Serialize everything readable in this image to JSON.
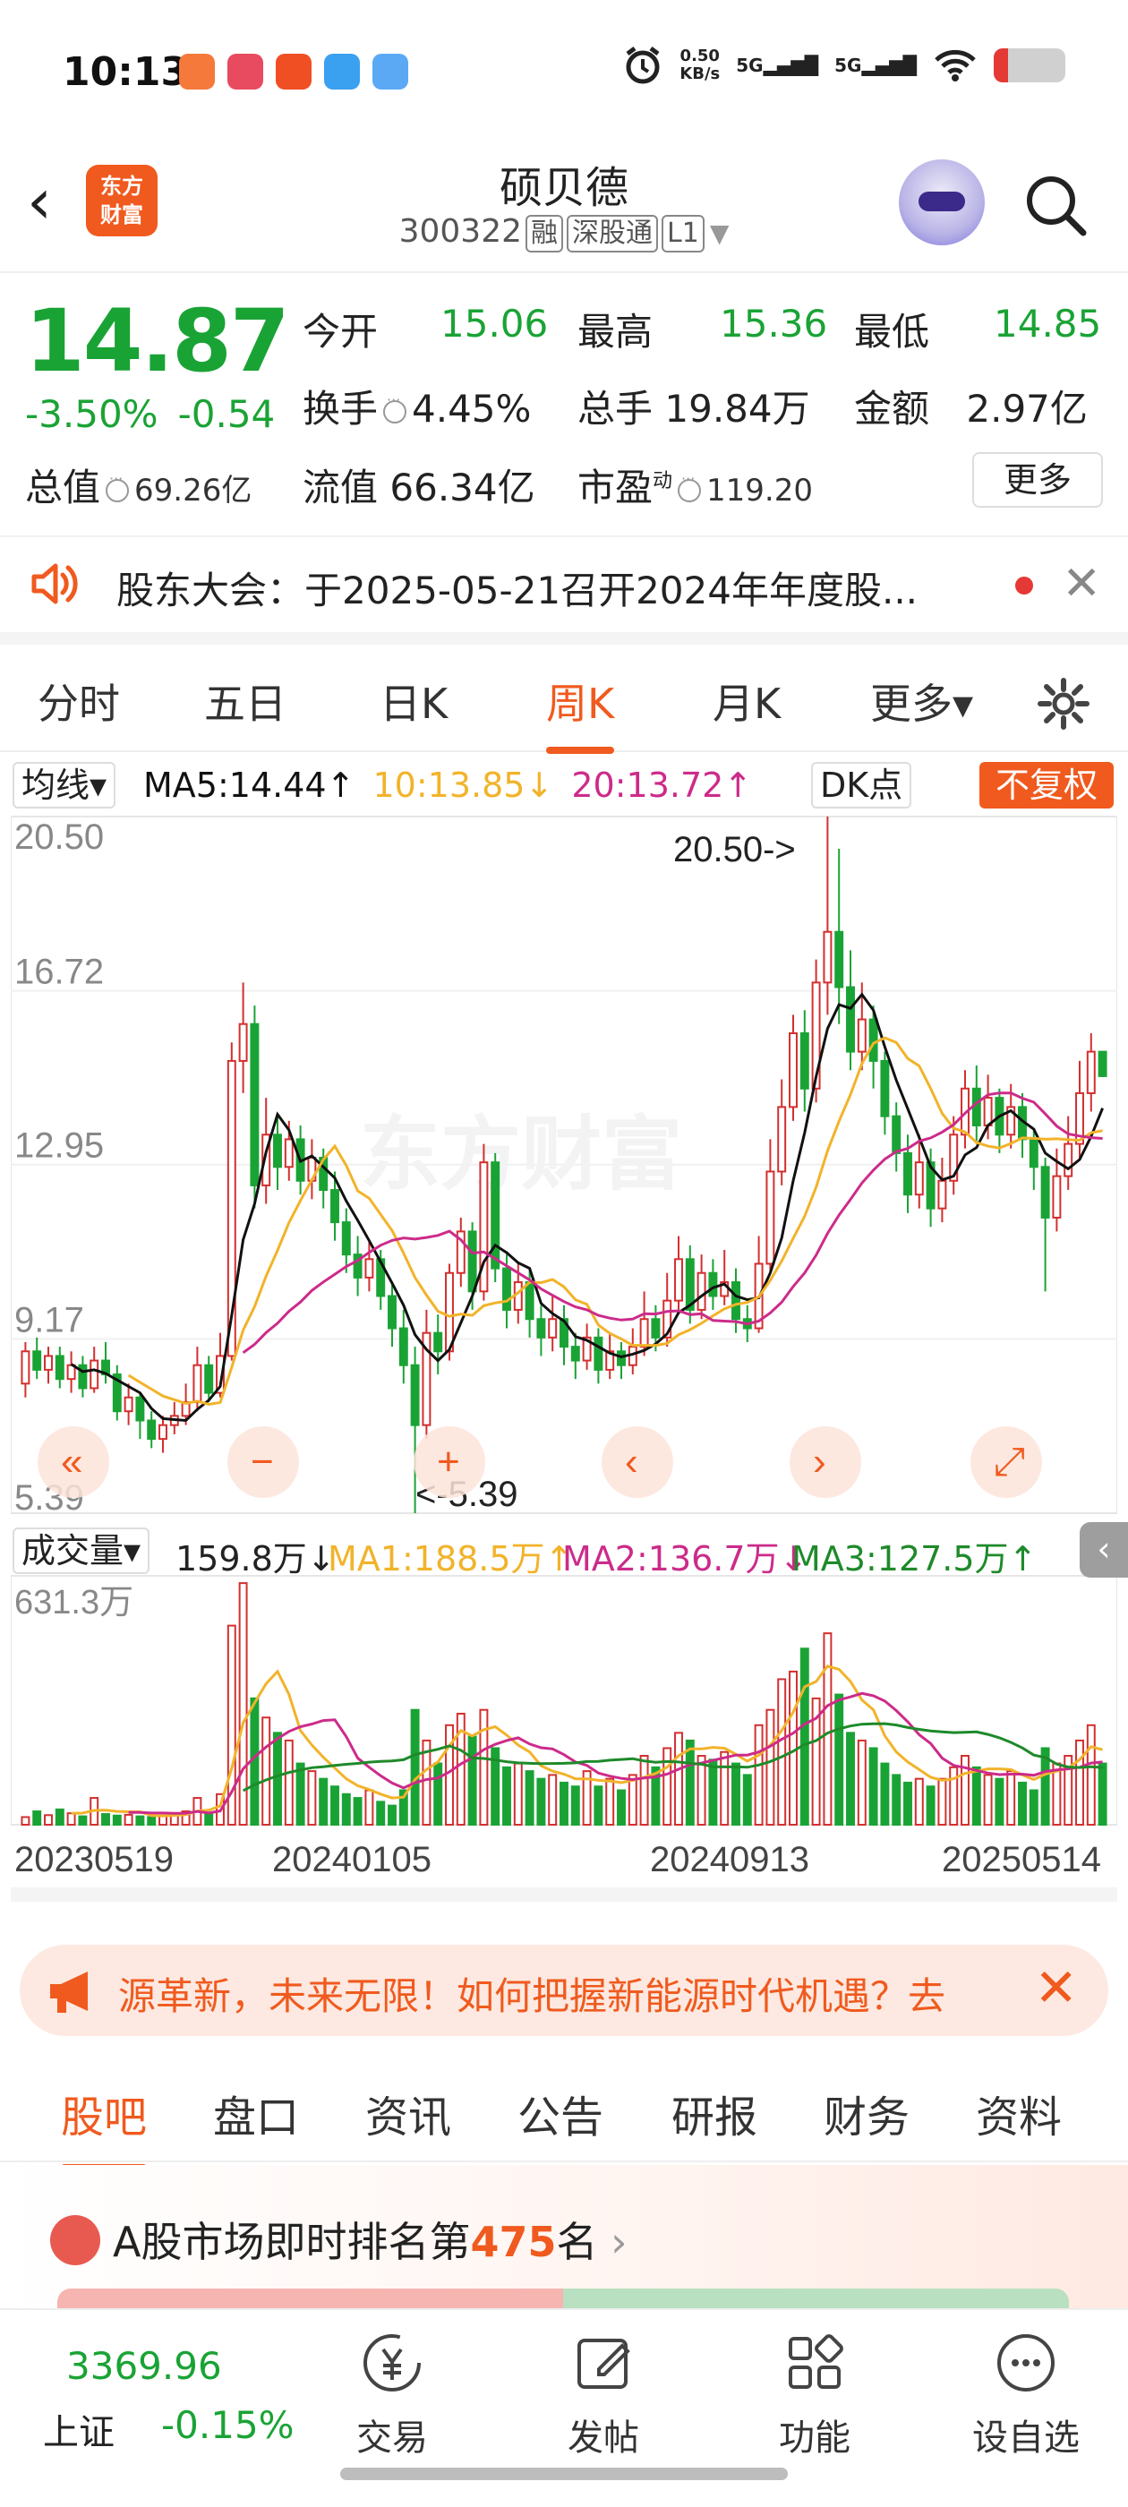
{
  "status_bar": {
    "time": "10:13",
    "net_speed": "0.50",
    "net_unit": "KB/s",
    "signal1": "5G",
    "signal2": "5G"
  },
  "header": {
    "logo_line1": "东方",
    "logo_line2": "财富",
    "stock_name": "硕贝德",
    "stock_code": "300322",
    "tags": [
      "融",
      "深股通",
      "L1"
    ]
  },
  "quote": {
    "price": "14.87",
    "change_pct": "-3.50%",
    "change_amt": "-0.54",
    "open_label": "今开",
    "open": "15.06",
    "high_label": "最高",
    "high": "15.36",
    "low_label": "最低",
    "low": "14.85",
    "turnover_label": "换手",
    "turnover": "4.45%",
    "volume_label": "总手",
    "volume": "19.84万",
    "amount_label": "金额",
    "amount": "2.97亿",
    "mktcap_label": "总值",
    "mktcap": "69.26亿",
    "float_label": "流值",
    "float": "66.34亿",
    "pe_label": "市盈",
    "pe_sup": "动",
    "pe": "119.20",
    "more": "更多"
  },
  "notice": {
    "text": "股东大会：于2025-05-21召开2024年年度股..."
  },
  "ktabs": [
    "分时",
    "五日",
    "日K",
    "周K",
    "月K",
    "更多▾"
  ],
  "ma_row": {
    "dropdown": "均线▾",
    "ma5": "MA5:14.44↑",
    "ma10": "10:13.85↓",
    "ma20": "20:13.72↑",
    "dk": "DK点",
    "fq": "不复权"
  },
  "colors": {
    "up": "#d32f2f",
    "down": "#1aa335",
    "ma5": "#111111",
    "ma10": "#f2b32a",
    "ma20": "#cc2b8a",
    "accent": "#f05a1e",
    "vol_ma3": "#1e8a2a"
  },
  "chart_data": [
    {
      "type": "candlestick",
      "title": "周K",
      "ylim": [
        5.39,
        20.5
      ],
      "y_ticks": [
        "20.50",
        "16.72",
        "12.95",
        "9.17",
        "5.39"
      ],
      "max_annotation": "20.50->",
      "min_annotation": "<-5.39",
      "candles": [
        [
          8.2,
          8.9,
          7.9,
          9.1
        ],
        [
          8.9,
          8.5,
          8.3,
          9.2
        ],
        [
          8.5,
          8.8,
          8.2,
          9.0
        ],
        [
          8.8,
          8.3,
          8.1,
          9.0
        ],
        [
          8.3,
          8.6,
          8.0,
          8.9
        ],
        [
          8.6,
          8.1,
          7.9,
          8.8
        ],
        [
          8.1,
          8.7,
          8.0,
          9.0
        ],
        [
          8.7,
          8.4,
          8.2,
          9.1
        ],
        [
          8.4,
          7.6,
          7.4,
          8.6
        ],
        [
          7.6,
          7.9,
          7.3,
          8.2
        ],
        [
          7.9,
          7.4,
          7.0,
          8.0
        ],
        [
          7.4,
          7.0,
          6.8,
          7.6
        ],
        [
          7.0,
          7.3,
          6.7,
          7.5
        ],
        [
          7.3,
          7.5,
          7.1,
          7.8
        ],
        [
          7.5,
          7.8,
          7.3,
          8.2
        ],
        [
          7.8,
          8.6,
          7.6,
          9.0
        ],
        [
          8.6,
          8.0,
          7.8,
          8.8
        ],
        [
          8.0,
          8.8,
          7.9,
          9.3
        ],
        [
          8.8,
          15.2,
          8.7,
          15.6
        ],
        [
          15.2,
          16.0,
          14.5,
          16.9
        ],
        [
          16.0,
          12.5,
          12.0,
          16.4
        ],
        [
          12.5,
          13.6,
          12.1,
          14.4
        ],
        [
          13.6,
          12.9,
          12.4,
          14.0
        ],
        [
          12.9,
          13.5,
          12.6,
          13.9
        ],
        [
          13.5,
          12.6,
          12.3,
          13.8
        ],
        [
          12.6,
          13.1,
          12.2,
          13.5
        ],
        [
          13.1,
          12.4,
          12.0,
          13.3
        ],
        [
          12.4,
          11.7,
          11.3,
          12.8
        ],
        [
          11.7,
          11.0,
          10.6,
          12.0
        ],
        [
          11.0,
          10.5,
          10.1,
          11.4
        ],
        [
          10.5,
          10.9,
          10.2,
          11.3
        ],
        [
          10.9,
          10.1,
          9.8,
          11.1
        ],
        [
          10.1,
          9.4,
          9.0,
          10.4
        ],
        [
          9.4,
          8.6,
          8.2,
          9.8
        ],
        [
          8.6,
          7.3,
          5.39,
          9.0
        ],
        [
          7.3,
          9.3,
          7.0,
          9.8
        ],
        [
          9.3,
          8.9,
          8.4,
          9.7
        ],
        [
          8.9,
          10.6,
          8.7,
          10.8
        ],
        [
          10.6,
          11.5,
          10.3,
          11.8
        ],
        [
          11.5,
          10.2,
          9.8,
          11.7
        ],
        [
          10.2,
          13.0,
          10.0,
          13.4
        ],
        [
          13.0,
          10.7,
          10.4,
          13.2
        ],
        [
          10.7,
          9.8,
          9.4,
          11.0
        ],
        [
          9.8,
          10.4,
          9.5,
          10.8
        ],
        [
          10.4,
          9.6,
          9.2,
          10.7
        ],
        [
          9.6,
          9.2,
          8.8,
          9.9
        ],
        [
          9.2,
          9.6,
          8.9,
          10.1
        ],
        [
          9.6,
          9.0,
          8.6,
          9.9
        ],
        [
          9.0,
          8.7,
          8.3,
          9.3
        ],
        [
          8.7,
          9.2,
          8.5,
          9.5
        ],
        [
          9.2,
          8.5,
          8.2,
          9.4
        ],
        [
          8.5,
          8.9,
          8.3,
          9.3
        ],
        [
          8.9,
          8.6,
          8.3,
          9.1
        ],
        [
          8.6,
          9.0,
          8.4,
          9.4
        ],
        [
          9.0,
          9.6,
          8.8,
          10.2
        ],
        [
          9.6,
          9.2,
          8.9,
          9.9
        ],
        [
          9.2,
          10.0,
          9.0,
          10.6
        ],
        [
          10.0,
          10.9,
          9.8,
          11.4
        ],
        [
          10.9,
          9.8,
          9.5,
          11.2
        ],
        [
          9.8,
          10.6,
          9.6,
          11.0
        ],
        [
          10.6,
          10.1,
          9.8,
          10.9
        ],
        [
          10.1,
          10.4,
          9.9,
          11.1
        ],
        [
          10.4,
          9.6,
          9.3,
          10.7
        ],
        [
          9.6,
          9.4,
          9.1,
          9.9
        ],
        [
          9.4,
          10.8,
          9.3,
          11.4
        ],
        [
          10.8,
          12.8,
          10.6,
          13.5
        ],
        [
          12.8,
          14.2,
          12.5,
          14.8
        ],
        [
          14.2,
          15.8,
          13.9,
          16.2
        ],
        [
          15.8,
          14.6,
          14.1,
          16.3
        ],
        [
          14.6,
          16.9,
          14.3,
          17.4
        ],
        [
          16.9,
          18.0,
          16.2,
          20.5
        ],
        [
          18.0,
          16.8,
          16.0,
          19.8
        ],
        [
          16.8,
          15.4,
          15.0,
          17.6
        ],
        [
          15.4,
          16.1,
          15.0,
          16.9
        ],
        [
          16.1,
          15.2,
          14.6,
          16.4
        ],
        [
          15.2,
          14.0,
          13.6,
          15.4
        ],
        [
          14.0,
          13.2,
          12.8,
          14.3
        ],
        [
          13.2,
          12.3,
          11.9,
          13.6
        ],
        [
          12.3,
          13.0,
          12.0,
          13.6
        ],
        [
          13.0,
          12.0,
          11.6,
          13.3
        ],
        [
          12.0,
          12.6,
          11.7,
          13.1
        ],
        [
          12.6,
          13.6,
          12.3,
          14.0
        ],
        [
          13.6,
          14.6,
          13.3,
          15.0
        ],
        [
          14.6,
          13.8,
          13.4,
          15.1
        ],
        [
          13.8,
          14.4,
          13.5,
          14.9
        ],
        [
          14.4,
          13.6,
          13.2,
          14.6
        ],
        [
          13.6,
          14.2,
          13.3,
          14.7
        ],
        [
          14.2,
          13.5,
          13.1,
          14.5
        ],
        [
          13.5,
          12.9,
          12.4,
          13.7
        ],
        [
          12.9,
          11.8,
          10.2,
          13.1
        ],
        [
          11.8,
          12.7,
          11.5,
          13.3
        ],
        [
          12.7,
          13.4,
          12.4,
          14.0
        ],
        [
          13.4,
          14.5,
          13.1,
          15.2
        ],
        [
          14.5,
          15.4,
          14.1,
          15.8
        ],
        [
          15.4,
          14.87,
          14.85,
          15.36
        ]
      ],
      "x_labels": [
        "20230519",
        "20240105",
        "20240913",
        "20250514"
      ]
    },
    {
      "type": "bar",
      "title": "成交量",
      "ylim": [
        0,
        631.3
      ],
      "y_ticks": [
        "631.3万"
      ],
      "values": [
        20,
        35,
        25,
        40,
        30,
        22,
        70,
        28,
        24,
        26,
        22,
        20,
        24,
        30,
        35,
        70,
        30,
        80,
        520,
        631,
        330,
        280,
        240,
        220,
        160,
        140,
        120,
        100,
        80,
        70,
        90,
        60,
        50,
        90,
        300,
        220,
        160,
        260,
        290,
        230,
        300,
        200,
        150,
        160,
        140,
        120,
        130,
        110,
        100,
        140,
        100,
        120,
        90,
        130,
        180,
        150,
        200,
        240,
        220,
        180,
        170,
        190,
        160,
        130,
        260,
        300,
        380,
        400,
        460,
        330,
        500,
        340,
        240,
        220,
        200,
        160,
        130,
        110,
        120,
        100,
        120,
        150,
        180,
        150,
        130,
        120,
        140,
        110,
        90,
        200,
        160,
        180,
        220,
        260,
        160
      ],
      "ma1": "MA1:188.5万↑",
      "ma2": "MA2:136.7万↓",
      "ma3": "MA3:127.5万↑",
      "current": "159.8万↓",
      "dropdown": "成交量▾"
    }
  ],
  "ad": {
    "text": "源革新，未来无限！如何把握新能源时代机遇？去"
  },
  "subtabs": [
    "股吧",
    "盘口",
    "资讯",
    "公告",
    "研报",
    "财务",
    "资料"
  ],
  "rank": {
    "prefix": "A股市场即时排名第",
    "number": "475",
    "suffix": "名"
  },
  "bottom": {
    "index_value": "3369.96",
    "index_name": "上证",
    "index_pct": "-0.15%",
    "nav": [
      "交易",
      "发帖",
      "功能",
      "设自选"
    ]
  }
}
